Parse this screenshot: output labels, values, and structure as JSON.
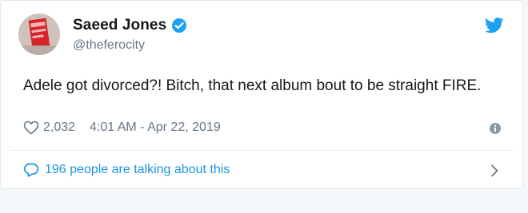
{
  "tweet": {
    "display_name": "Saeed Jones",
    "handle": "@theferocity",
    "text": "Adele got divorced?! Bitch, that next album bout to be straight FIRE.",
    "like_count": "2,032",
    "timestamp": "4:01 AM - Apr 22, 2019",
    "talking": "196 people are talking about this"
  },
  "icons": {
    "verified": "verified-badge-icon",
    "brand": "twitter-bird-icon",
    "like": "heart-outline-icon",
    "info": "info-circle-icon",
    "reply": "speech-bubble-icon",
    "chevron": "chevron-right-icon"
  },
  "colors": {
    "accent": "#1da1f2",
    "link": "#1b95e0",
    "muted": "#657786",
    "text": "#14171a",
    "divider": "#e6ecf0"
  }
}
